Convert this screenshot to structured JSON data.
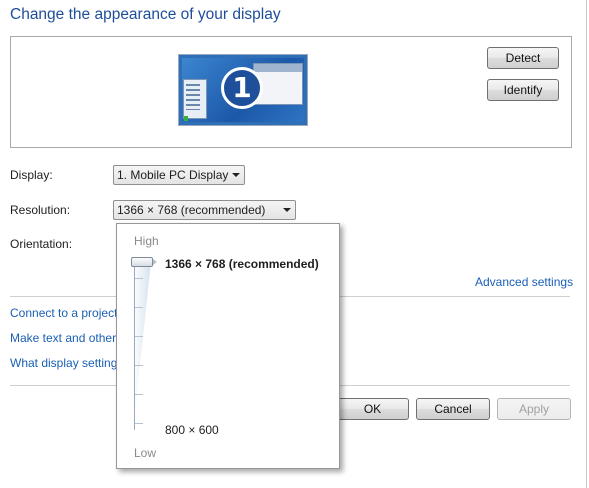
{
  "page": {
    "title": "Change the appearance of your display"
  },
  "preview": {
    "monitor_number": "1",
    "detect_label": "Detect",
    "identify_label": "Identify"
  },
  "settings": {
    "display_label": "Display:",
    "display_value": "1. Mobile PC Display",
    "resolution_label": "Resolution:",
    "resolution_value": "1366 × 768 (recommended)",
    "orientation_label": "Orientation:",
    "advanced_link": "Advanced settings"
  },
  "links": [
    {
      "text": "Connect to a projector"
    },
    {
      "text": "Make text and other items larger or smaller"
    },
    {
      "text": "What display settings should I choose?"
    }
  ],
  "resolution_dropdown": {
    "high_label": "High",
    "low_label": "Low",
    "selected_option": "1366 × 768 (recommended)",
    "min_option": "800 × 600",
    "slider_position": 1.0
  },
  "buttons": {
    "ok": "OK",
    "cancel": "Cancel",
    "apply": "Apply"
  },
  "colors": {
    "title": "#1e4d9a",
    "link": "#1a5fb4",
    "monitor": "#2e6fb7"
  }
}
